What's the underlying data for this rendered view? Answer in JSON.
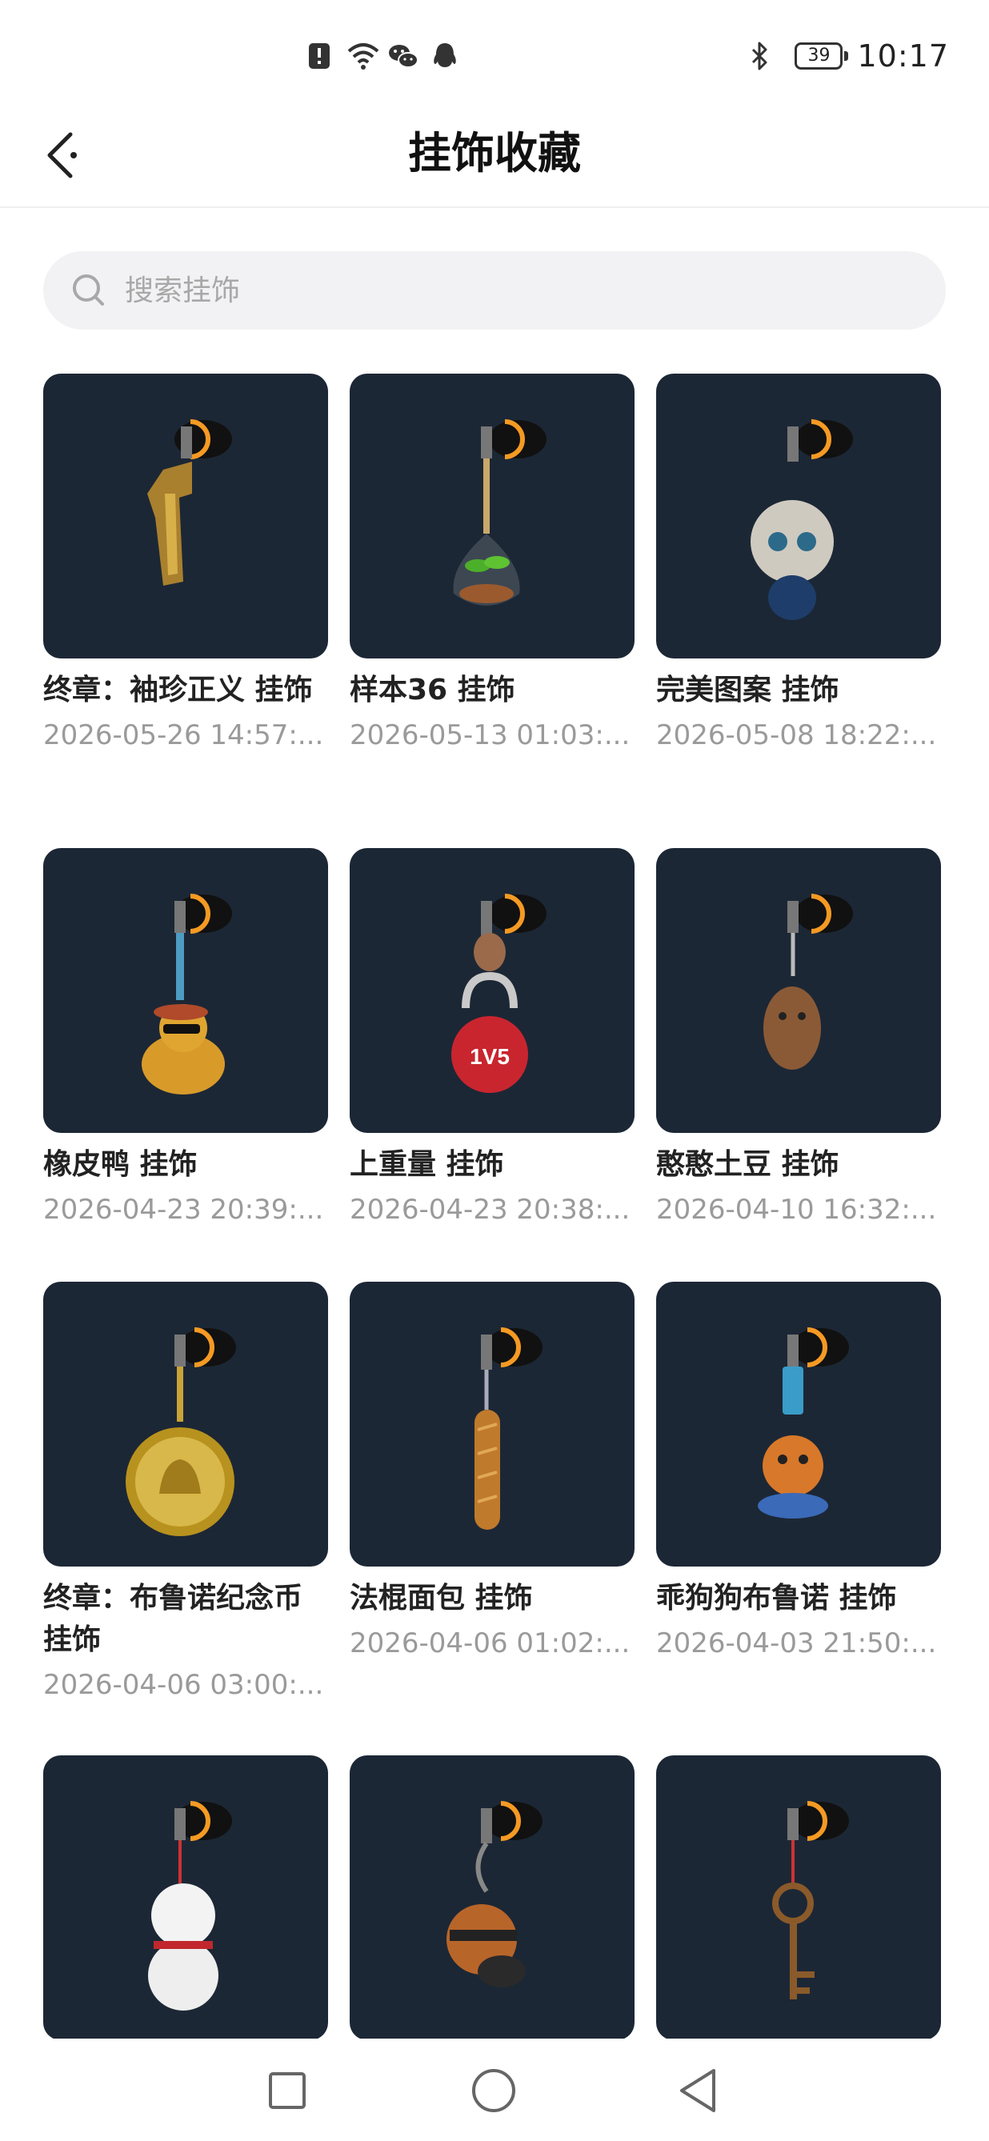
{
  "status_bar": {
    "icons": [
      "notification-alert-icon",
      "wifi-icon",
      "wechat-icon",
      "qq-icon"
    ],
    "bluetooth_icon": "bluetooth-icon",
    "battery": "39",
    "time": "10:17"
  },
  "header": {
    "back_icon": "back-arrow-icon",
    "title": "挂饰收藏"
  },
  "search": {
    "icon": "search-icon",
    "placeholder": "搜索挂饰"
  },
  "colors": {
    "card_bg": "#1c2735",
    "accent_orange": "#f59a23"
  },
  "items": [
    {
      "title": " 终章：袖珍正义 挂饰",
      "date": "2026-05-26 14:57:..."
    },
    {
      "title": "样本36 挂饰",
      "date": "2026-05-13 01:03:..."
    },
    {
      "title": "完美图案 挂饰",
      "date": "2026-05-08 18:22:..."
    },
    {
      "title": "橡皮鸭 挂饰",
      "date": "2026-04-23 20:39:..."
    },
    {
      "title": " 上重量 挂饰",
      "date": "2026-04-23 20:38:..."
    },
    {
      "title": "憨憨土豆 挂饰",
      "date": "2026-04-10 16:32:..."
    },
    {
      "title": "终章：布鲁诺纪念币 挂饰",
      "date": "2026-04-06 03:00:..."
    },
    {
      "title": "法棍面包 挂饰",
      "date": "2026-04-06 01:02:..."
    },
    {
      "title": "乖狗狗布鲁诺 挂饰",
      "date": "2026-04-03 21:50:..."
    },
    {
      "title": "",
      "date": ""
    },
    {
      "title": "",
      "date": ""
    },
    {
      "title": "",
      "date": ""
    }
  ],
  "item_art": {
    "coin_text": "1V5"
  },
  "nav_bar": {
    "recents_icon": "square-recents-icon",
    "home_icon": "circle-home-icon",
    "back_icon": "triangle-back-icon"
  }
}
